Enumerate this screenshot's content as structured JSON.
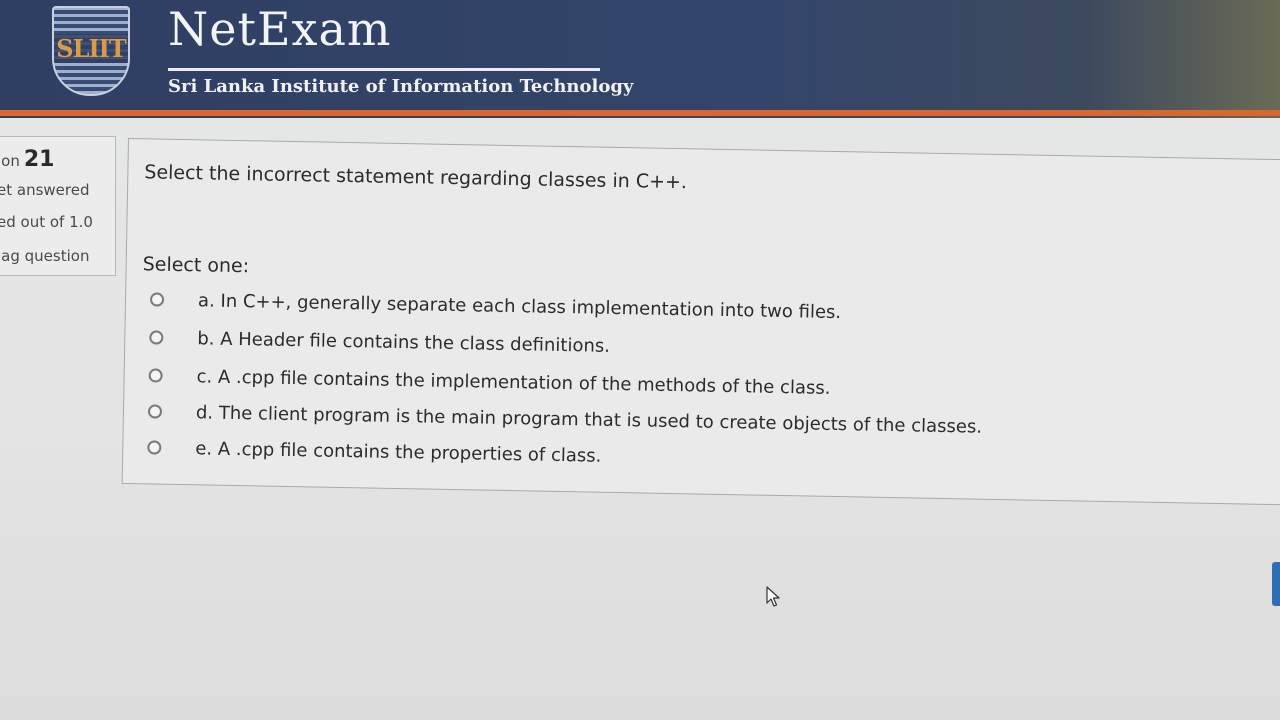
{
  "header": {
    "logo_text": "SLIIT",
    "brand": "NetExam",
    "subtitle": "Sri Lanka Institute of Information Technology"
  },
  "info_panel": {
    "question_label": "ion",
    "question_number": "21",
    "state": "et answered",
    "marks": "ed out of 1.0",
    "flag": "lag question"
  },
  "question": {
    "text": "Select the incorrect statement regarding classes in C++.",
    "prompt": "Select one:",
    "options": [
      {
        "label": "a. In C++, generally separate each class implementation into two files."
      },
      {
        "label": "b. A Header file contains the class definitions."
      },
      {
        "label": "c. A .cpp file contains the implementation of the methods of the class."
      },
      {
        "label": "d. The client program is the main program that is used to create objects of the classes."
      },
      {
        "label": "e. A .cpp file contains the properties of class."
      }
    ]
  }
}
